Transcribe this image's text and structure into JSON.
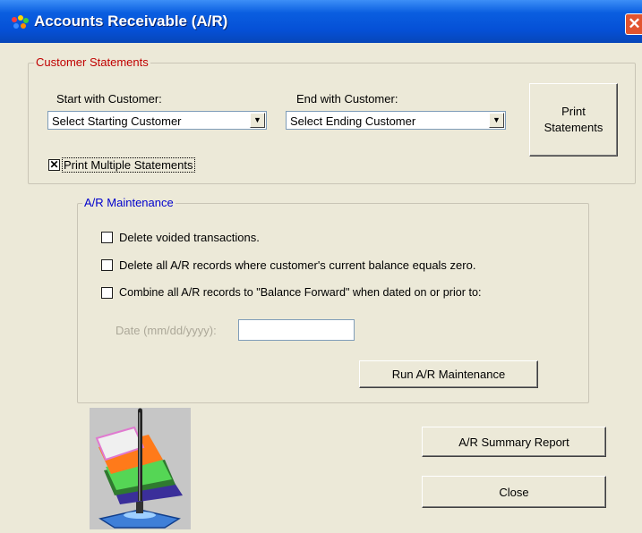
{
  "window": {
    "title": "Accounts Receivable (A/R)",
    "close_glyph": "✕"
  },
  "statements": {
    "legend": "Customer Statements",
    "start_label": "Start with Customer:",
    "start_value": "Select Starting Customer",
    "end_label": "End with Customer:",
    "end_value": "Select Ending Customer",
    "print_line1": "Print",
    "print_line2": "Statements",
    "multiple_label": "Print Multiple Statements",
    "multiple_checked": true
  },
  "maintenance": {
    "legend": "A/R Maintenance",
    "opt1": "Delete voided transactions.",
    "opt2": "Delete all A/R records where customer's current balance equals zero.",
    "opt3": "Combine all A/R records to  \"Balance Forward\" when dated on or prior to:",
    "date_label": "Date  (mm/dd/yyyy):",
    "date_value": "",
    "run_label": "Run A/R Maintenance"
  },
  "actions": {
    "summary_label": "A/R Summary Report",
    "close_label": "Close"
  },
  "colors": {
    "titlebar": "#0550d6",
    "legend_red": "#c00000",
    "legend_blue": "#0000cc",
    "disabled_text": "#aca899"
  }
}
